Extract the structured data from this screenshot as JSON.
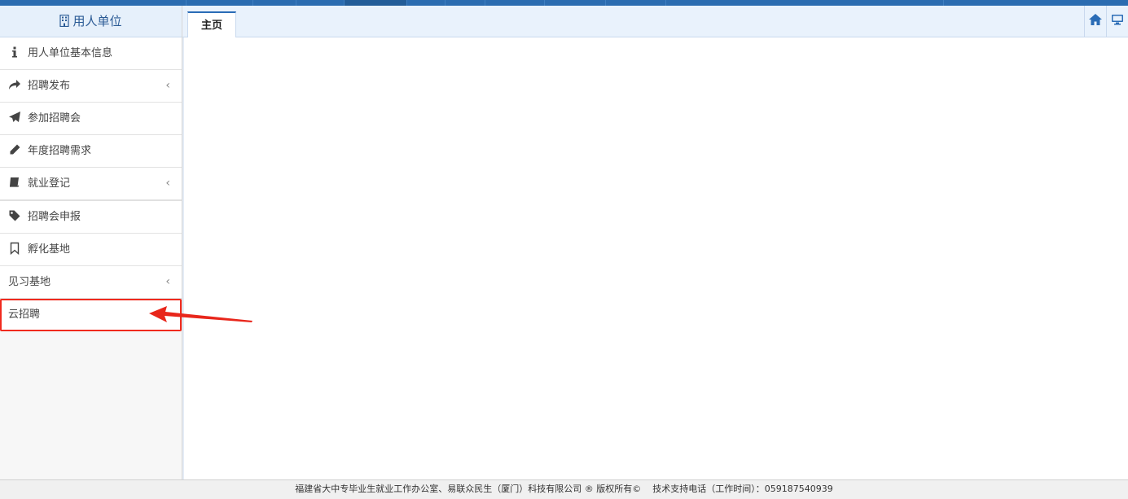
{
  "sidebar": {
    "title": "用人单位",
    "title_icon": "building-icon",
    "items": [
      {
        "label": "用人单位基本信息",
        "icon": "info-icon"
      },
      {
        "label": "招聘发布",
        "icon": "share-arrow-icon",
        "has_submenu": true
      },
      {
        "label": "参加招聘会",
        "icon": "paper-plane-icon"
      },
      {
        "label": "年度招聘需求",
        "icon": "pencil-icon"
      },
      {
        "label": "就业登记",
        "icon": "book-icon",
        "has_submenu": true
      },
      {
        "label": "招聘会申报",
        "icon": "tag-icon"
      },
      {
        "label": "孵化基地",
        "icon": "bookmark-icon"
      },
      {
        "label": "见习基地",
        "has_submenu": true
      },
      {
        "label": "云招聘",
        "highlighted": true
      }
    ]
  },
  "tabs": [
    {
      "label": "主页",
      "active": true
    }
  ],
  "toolbar": {
    "home_icon": "home-icon",
    "screen_icon": "monitor-icon"
  },
  "footer": {
    "copyright": "福建省大中专毕业生就业工作办公室、易联众民生（厦门）科技有限公司 ® 版权所有©",
    "support": "技术支持电话（工作时间）：059187540939"
  },
  "colors": {
    "accent": "#2b6cb0",
    "annotation": "#f02a1e"
  }
}
